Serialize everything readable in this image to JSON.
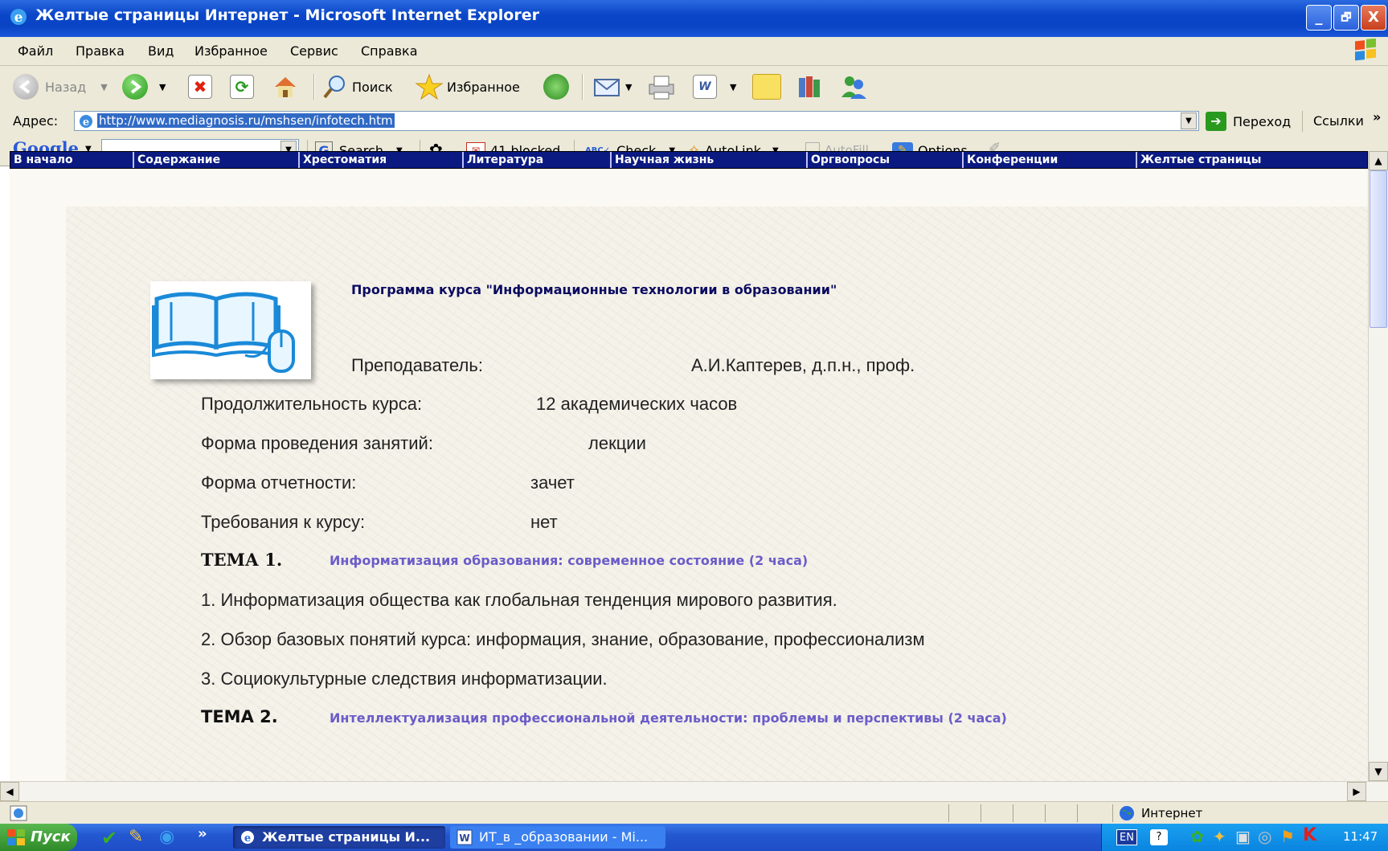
{
  "window": {
    "title": "Желтые страницы Интернет - Microsoft Internet Explorer",
    "minimize": "_",
    "maximize": "🗗",
    "close": "X"
  },
  "menu": [
    "Файл",
    "Правка",
    "Вид",
    "Избранное",
    "Сервис",
    "Справка"
  ],
  "toolbar": {
    "back_label": "Назад",
    "search_label": "Поиск",
    "favorites_label": "Избранное"
  },
  "address": {
    "label": "Адрес:",
    "url": "http://www.mediagnosis.ru/mshsen/infotech.htm",
    "go_label": "Переход",
    "links_label": "Ссылки",
    "chevron": "»"
  },
  "googlebar": {
    "logo": "Google",
    "search_label": "Search",
    "blocked_label": "41 blocked",
    "check_label": "Check",
    "autolink_label": "AutoLink",
    "autofill_label": "AutoFill",
    "options_label": "Options"
  },
  "sitenav": [
    "В начало",
    "Содержание",
    "Хрестоматия",
    "Литература",
    "Научная жизнь",
    "Оргвопросы",
    "Конференции",
    "Желтые страницы"
  ],
  "content": {
    "program_title": "Программа курса \"Информационные технологии в образовании\"",
    "teacher_label": "Преподаватель:",
    "teacher_value": "А.И.Каптерев, д.п.н., проф.",
    "rows": [
      {
        "label": "Продолжительность курса:",
        "value": "12 академических часов"
      },
      {
        "label": "Форма проведения занятий:",
        "value": "лекции"
      },
      {
        "label": "Форма отчетности:",
        "value": "зачет"
      },
      {
        "label": "Требования к курсу:",
        "value": "нет"
      }
    ],
    "tema1_label": "ТЕМА 1.",
    "tema1_title": "Информатизация образования: современное состояние (2 часа)",
    "items": [
      "1.  Информатизация общества как глобальная тенденция мирового развития.",
      "2.  Обзор базовых понятий курса: информация, знание, образование, профессионализм",
      "3.  Социокультурные следствия информатизации."
    ],
    "tema2_label": "ТЕМА 2.",
    "tema2_title": "Интеллектуализация профессиональной деятельности: проблемы и перспективы (2 часа)"
  },
  "status": {
    "zone": "Интернет"
  },
  "taskbar": {
    "start": "Пуск",
    "chevron": "»",
    "task1": "Желтые страницы И...",
    "task2": "ИТ_в _образовании - Mi...",
    "lang": "EN",
    "clock": "11:47"
  },
  "colors": {
    "nav_bg": "#0a1a80",
    "link": "#6b5cc8",
    "title_blue": "#0a46c8"
  }
}
